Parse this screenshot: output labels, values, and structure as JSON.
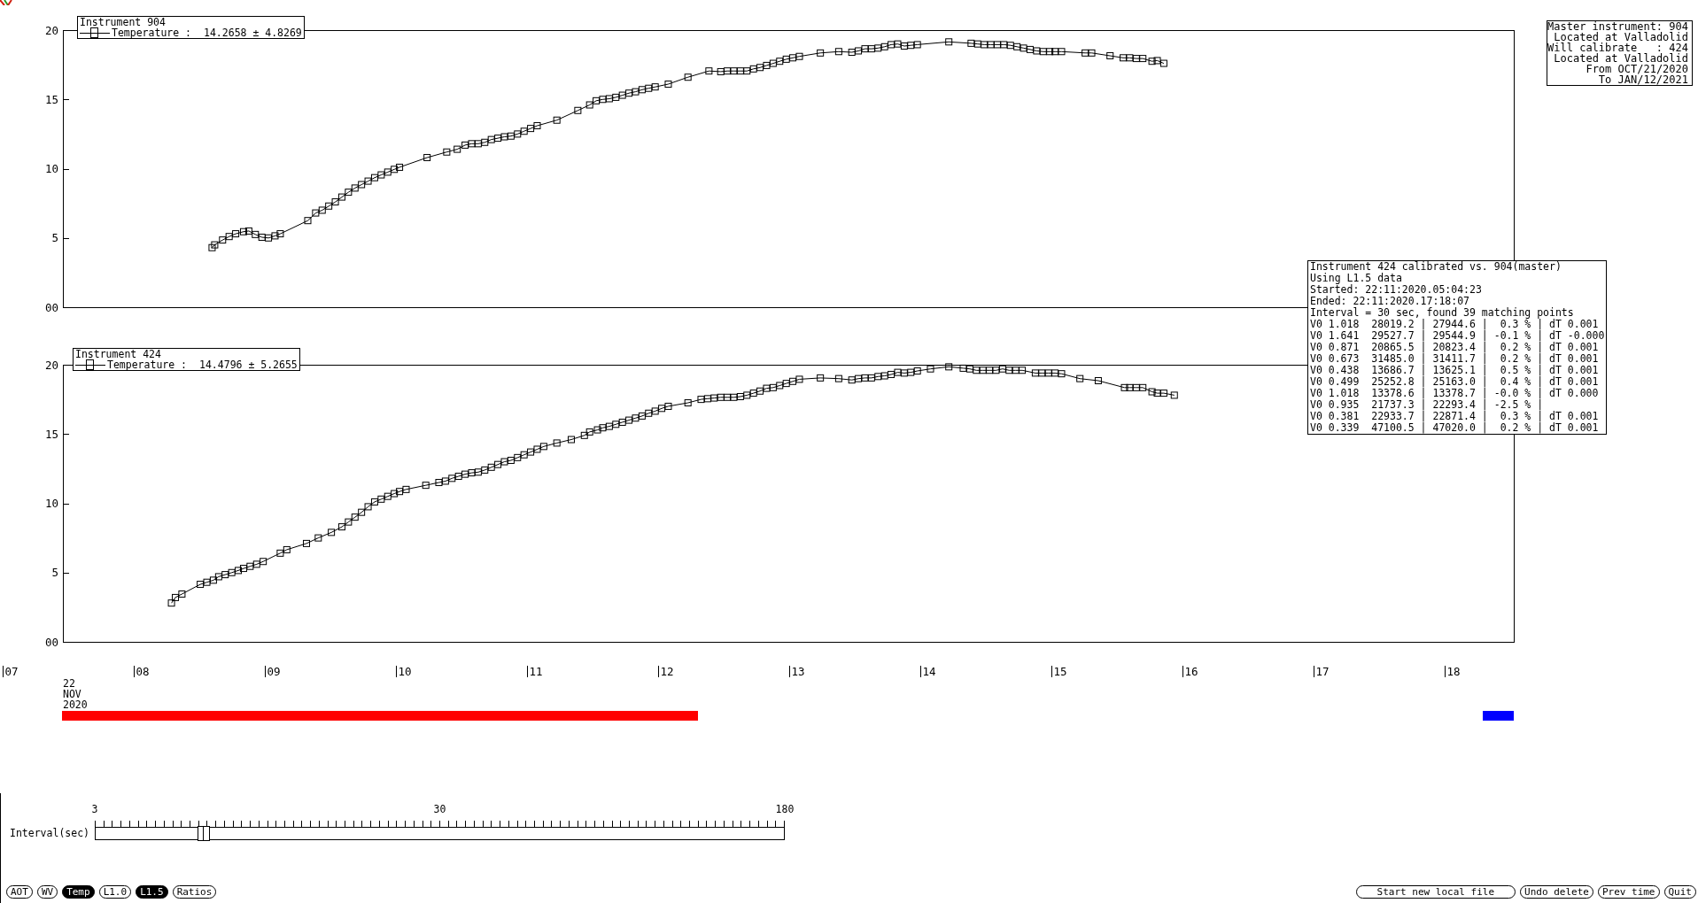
{
  "plots": [
    {
      "legend": {
        "title": "Instrument 904",
        "label": "Temperature :",
        "stats": "14.2658 ± 4.8269"
      },
      "chart_data": {
        "type": "line",
        "x": [
          8.53,
          8.55,
          8.61,
          8.66,
          8.71,
          8.77,
          8.81,
          8.86,
          8.91,
          8.96,
          9.01,
          9.05,
          9.26,
          9.32,
          9.37,
          9.42,
          9.47,
          9.52,
          9.57,
          9.62,
          9.67,
          9.72,
          9.77,
          9.82,
          9.87,
          9.92,
          9.96,
          10.17,
          10.32,
          10.4,
          10.46,
          10.51,
          10.56,
          10.61,
          10.66,
          10.71,
          10.76,
          10.81,
          10.86,
          10.91,
          10.96,
          11.01,
          11.16,
          11.32,
          11.41,
          11.46,
          11.51,
          11.56,
          11.61,
          11.66,
          11.71,
          11.76,
          11.81,
          11.86,
          11.91,
          12.01,
          12.16,
          12.32,
          12.41,
          12.46,
          12.51,
          12.56,
          12.61,
          12.66,
          12.71,
          12.76,
          12.81,
          12.86,
          12.91,
          12.96,
          13.01,
          13.17,
          13.31,
          13.41,
          13.46,
          13.51,
          13.56,
          13.61,
          13.66,
          13.71,
          13.76,
          13.81,
          13.86,
          13.91,
          14.15,
          14.32,
          14.37,
          14.42,
          14.47,
          14.52,
          14.57,
          14.62,
          14.67,
          14.72,
          14.77,
          14.82,
          14.87,
          14.92,
          14.96,
          15.01,
          15.19,
          15.24,
          15.38,
          15.48,
          15.53,
          15.58,
          15.63,
          15.7,
          15.74,
          15.79
        ],
        "series": [
          {
            "marker": "square",
            "values": [
              4.3,
              4.5,
              4.85,
              5.1,
              5.3,
              5.45,
              5.5,
              5.25,
              5.05,
              5.0,
              5.15,
              5.3,
              6.25,
              6.8,
              7.0,
              7.3,
              7.6,
              7.95,
              8.3,
              8.6,
              8.85,
              9.1,
              9.35,
              9.55,
              9.75,
              9.95,
              10.1,
              10.8,
              11.2,
              11.4,
              11.7,
              11.8,
              11.8,
              11.9,
              12.1,
              12.2,
              12.3,
              12.35,
              12.5,
              12.7,
              12.9,
              13.1,
              13.5,
              14.2,
              14.6,
              14.9,
              15.0,
              15.05,
              15.15,
              15.3,
              15.45,
              15.55,
              15.7,
              15.8,
              15.9,
              16.1,
              16.6,
              17.05,
              17.0,
              17.05,
              17.05,
              17.05,
              17.05,
              17.2,
              17.3,
              17.45,
              17.6,
              17.75,
              17.9,
              18.0,
              18.1,
              18.35,
              18.45,
              18.4,
              18.5,
              18.65,
              18.65,
              18.7,
              18.8,
              18.95,
              19.0,
              18.85,
              18.9,
              18.95,
              19.15,
              19.05,
              19.0,
              18.95,
              18.95,
              18.95,
              18.95,
              18.9,
              18.8,
              18.7,
              18.6,
              18.5,
              18.45,
              18.45,
              18.45,
              18.45,
              18.35,
              18.35,
              18.15,
              18.0,
              18.0,
              17.95,
              17.95,
              17.75,
              17.8,
              17.6
            ]
          }
        ],
        "xlim": [
          7,
          18.5
        ],
        "ylim": [
          0,
          20
        ],
        "yticks": [
          {
            "value": 0,
            "label": "00"
          },
          5,
          10,
          15,
          20
        ]
      }
    },
    {
      "legend": {
        "title": "Instrument 424",
        "label": "Temperature :",
        "stats": "14.4796 ± 5.2655"
      },
      "chart_data": {
        "type": "line",
        "x": [
          8.22,
          8.25,
          8.3,
          8.44,
          8.49,
          8.54,
          8.58,
          8.63,
          8.68,
          8.73,
          8.77,
          8.82,
          8.87,
          8.92,
          9.05,
          9.1,
          9.25,
          9.34,
          9.44,
          9.52,
          9.57,
          9.62,
          9.67,
          9.72,
          9.77,
          9.82,
          9.87,
          9.92,
          9.96,
          10.01,
          10.16,
          10.26,
          10.31,
          10.36,
          10.41,
          10.46,
          10.51,
          10.56,
          10.61,
          10.66,
          10.71,
          10.76,
          10.81,
          10.86,
          10.91,
          10.96,
          11.01,
          11.06,
          11.16,
          11.27,
          11.37,
          11.41,
          11.47,
          11.51,
          11.56,
          11.61,
          11.66,
          11.71,
          11.76,
          11.81,
          11.86,
          11.91,
          11.96,
          12.01,
          12.16,
          12.26,
          12.31,
          12.36,
          12.41,
          12.46,
          12.51,
          12.56,
          12.61,
          12.66,
          12.71,
          12.76,
          12.81,
          12.86,
          12.91,
          12.96,
          13.01,
          13.17,
          13.31,
          13.41,
          13.46,
          13.51,
          13.56,
          13.61,
          13.66,
          13.71,
          13.76,
          13.81,
          13.86,
          13.91,
          14.01,
          14.15,
          14.26,
          14.31,
          14.36,
          14.41,
          14.46,
          14.51,
          14.56,
          14.61,
          14.66,
          14.71,
          14.81,
          14.86,
          14.91,
          14.96,
          15.01,
          15.15,
          15.29,
          15.49,
          15.53,
          15.58,
          15.63,
          15.7,
          15.74,
          15.79,
          15.87
        ],
        "series": [
          {
            "marker": "square",
            "values": [
              2.8,
              3.2,
              3.45,
              4.15,
              4.3,
              4.45,
              4.7,
              4.85,
              5.0,
              5.15,
              5.3,
              5.45,
              5.6,
              5.8,
              6.4,
              6.65,
              7.1,
              7.5,
              7.9,
              8.3,
              8.65,
              9.0,
              9.35,
              9.75,
              10.1,
              10.3,
              10.5,
              10.7,
              10.85,
              11.0,
              11.3,
              11.5,
              11.6,
              11.8,
              11.95,
              12.1,
              12.2,
              12.25,
              12.4,
              12.6,
              12.8,
              13.0,
              13.1,
              13.3,
              13.5,
              13.7,
              13.9,
              14.1,
              14.35,
              14.6,
              14.9,
              15.15,
              15.3,
              15.45,
              15.55,
              15.7,
              15.85,
              16.0,
              16.15,
              16.3,
              16.5,
              16.65,
              16.85,
              17.0,
              17.25,
              17.5,
              17.55,
              17.6,
              17.65,
              17.65,
              17.65,
              17.7,
              17.8,
              17.95,
              18.1,
              18.3,
              18.35,
              18.5,
              18.65,
              18.8,
              18.95,
              19.05,
              19.0,
              18.9,
              19.0,
              19.05,
              19.05,
              19.15,
              19.2,
              19.3,
              19.45,
              19.4,
              19.45,
              19.55,
              19.7,
              19.85,
              19.75,
              19.7,
              19.6,
              19.6,
              19.6,
              19.6,
              19.7,
              19.6,
              19.6,
              19.6,
              19.4,
              19.4,
              19.4,
              19.4,
              19.35,
              19.0,
              18.85,
              18.35,
              18.35,
              18.35,
              18.35,
              18.05,
              17.95,
              17.95,
              17.8
            ]
          }
        ],
        "xlim": [
          7,
          18.5
        ],
        "ylim": [
          0,
          20
        ],
        "yticks": [
          {
            "value": 0,
            "label": "00"
          },
          5,
          10,
          15,
          20
        ],
        "xticks": [
          {
            "value": 7,
            "label": "07"
          },
          {
            "value": 8,
            "label": "08"
          },
          {
            "value": 9,
            "label": "09"
          },
          10,
          11,
          12,
          13,
          14,
          15,
          16,
          17,
          18
        ]
      }
    }
  ],
  "timeline": {
    "date": [
      "22",
      "NOV",
      "2020"
    ],
    "bars": [
      {
        "color": "#ff0000"
      },
      {
        "color": "#0000ff"
      }
    ]
  },
  "master_info": [
    "Master instrument: 904",
    "Located at Valladolid",
    "Will calibrate   : 424",
    "Located at Valladolid",
    "From OCT/21/2020",
    "To JAN/12/2021"
  ],
  "calibration_report": {
    "header": [
      "Instrument 424 calibrated vs. 904(master)",
      "Using L1.5 data",
      "Started: 22:11:2020.05:04:23",
      "Ended: 22:11:2020.17:18:07",
      "Interval = 30 sec, found 39 matching points"
    ],
    "rows": [
      "V0 1.018  28019.2 | 27944.6 |  0.3 % | dT 0.001",
      "V0 1.641  29527.7 | 29544.9 | -0.1 % | dT -0.000",
      "V0 0.871  20865.5 | 20823.4 |  0.2 % | dT 0.001",
      "V0 0.673  31485.0 | 31411.7 |  0.2 % | dT 0.001",
      "V0 0.438  13686.7 | 13625.1 |  0.5 % | dT 0.001",
      "V0 0.499  25252.8 | 25163.0 |  0.4 % | dT 0.001",
      "V0 1.018  13378.6 | 13378.7 | -0.0 % | dT 0.000",
      "V0 0.935  21737.3 | 22293.4 | -2.5 % |",
      "V0 0.381  22933.7 | 22871.4 |  0.3 % | dT 0.001",
      "V0 0.339  47100.5 | 47020.0 |  0.2 % | dT 0.001"
    ]
  },
  "interval_slider": {
    "label": "Interval(sec)",
    "scale_labels": [
      "3",
      "30",
      "180"
    ],
    "level": 0.157
  },
  "mode_buttons": [
    {
      "label": "AOT",
      "selected": false
    },
    {
      "label": "WV",
      "selected": false
    },
    {
      "label": "Temp",
      "selected": true
    },
    {
      "label": "L1.0",
      "selected": false
    },
    {
      "label": "L1.5",
      "selected": true
    },
    {
      "label": "Ratios",
      "selected": false
    }
  ],
  "action_buttons": [
    {
      "label": "Start new local file"
    },
    {
      "label": "Undo delete"
    },
    {
      "label": "Prev time"
    },
    {
      "label": "Quit"
    }
  ]
}
